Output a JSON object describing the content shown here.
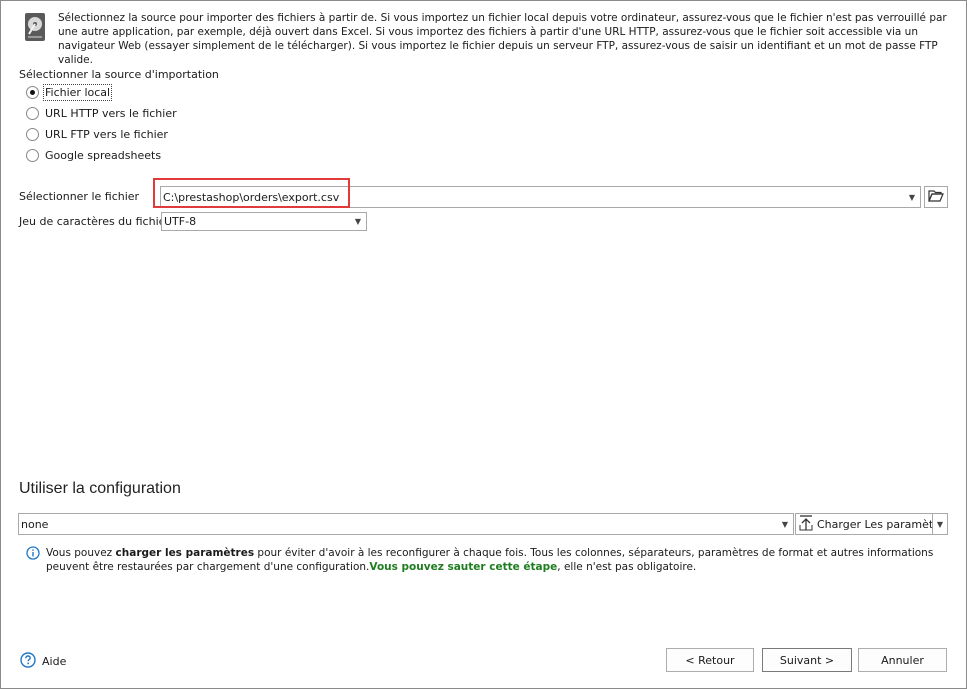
{
  "intro": {
    "text": "Sélectionnez la source pour importer des fichiers à partir de. Si vous importez un fichier local depuis votre ordinateur, assurez-vous que le fichier n'est pas verrouillé par une autre application, par exemple, déjà ouvert dans Excel. Si vous importez des fichiers à partir d'une URL HTTP, assurez-vous que le fichier soit accessible via un navigateur Web (essayer simplement de le télécharger). Si vous importez le fichier depuis un serveur FTP, assurez-vous de saisir un identifiant et un mot de passe FTP valide.",
    "icon": "hard-disk-icon"
  },
  "source": {
    "label": "Sélectionner la source d'importation",
    "options": [
      {
        "label": "Fichier local",
        "selected": true
      },
      {
        "label": "URL HTTP vers le fichier",
        "selected": false
      },
      {
        "label": "URL FTP vers le fichier",
        "selected": false
      },
      {
        "label": "Google spreadsheets",
        "selected": false
      }
    ]
  },
  "file": {
    "label": "Sélectionner le fichier",
    "value": "C:\\prestashop\\orders\\export.csv",
    "browse_icon": "folder-open-icon"
  },
  "charset": {
    "label": "Jeu de caractères du fichier",
    "value": "UTF-8"
  },
  "config": {
    "title": "Utiliser la configuration",
    "value": "none",
    "load_label": "Charger Les paramètre",
    "load_icon": "upload-icon"
  },
  "info": {
    "icon": "info-icon",
    "part1": "Vous pouvez ",
    "bold": "charger les paramètres",
    "part2": " pour éviter d'avoir à les reconfigurer à chaque fois. Tous les colonnes, séparateurs, paramètres de format et autres informations peuvent être restaurées par chargement d'une configuration.",
    "green": "Vous pouvez sauter cette étape",
    "part3": ", elle n'est pas obligatoire."
  },
  "footer": {
    "help_label": "Aide",
    "help_icon": "question-icon",
    "back_label": "< Retour",
    "next_label": "Suivant >",
    "cancel_label": "Annuler"
  },
  "colors": {
    "highlight": "#e03a3a",
    "accent": "#1e78c8",
    "green": "#1e7d1e"
  }
}
